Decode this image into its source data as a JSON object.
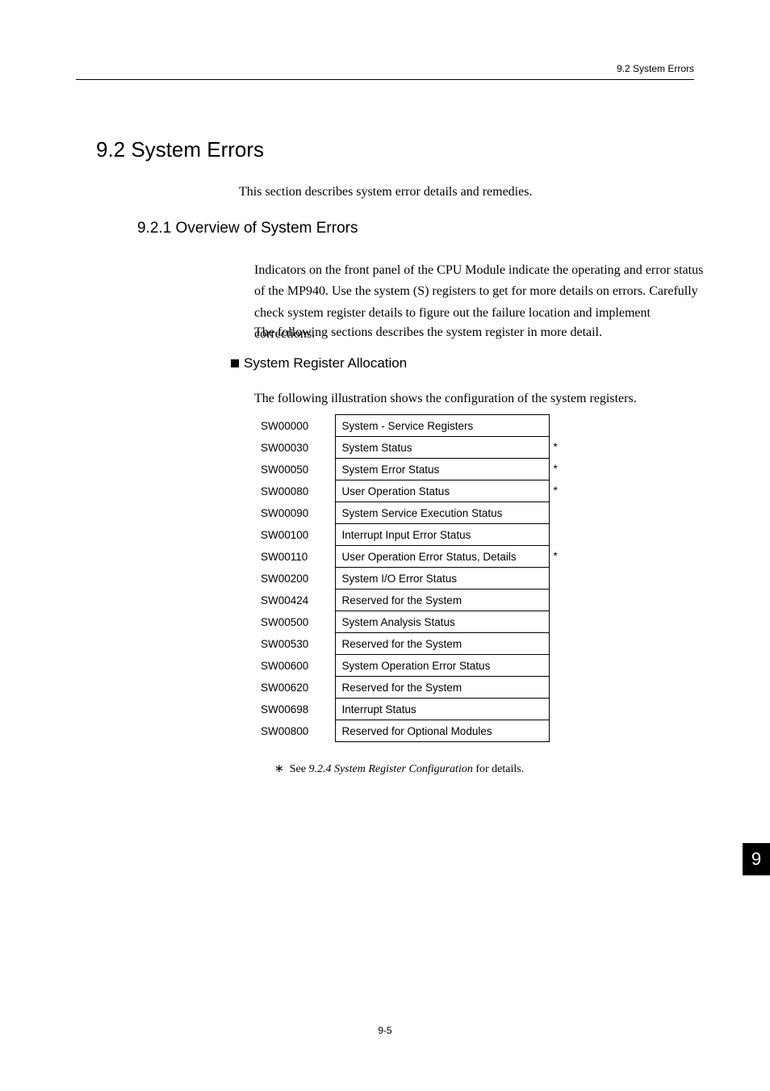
{
  "header": {
    "section_ref": "9.2  System Errors"
  },
  "section": {
    "title": "9.2  System Errors",
    "intro": "This section describes system error details and remedies."
  },
  "subsection": {
    "title": "9.2.1  Overview of System Errors",
    "para1": "Indicators on the front panel of the CPU Module indicate the operating and error status of the MP940. Use the system (S) registers to get for more details on errors. Carefully check system register details to figure out the failure location and implement corrections.",
    "para2": "The following sections describes the system register in more detail."
  },
  "bullet_heading": "System Register Allocation",
  "para3": "The following illustration shows the configuration of the system registers.",
  "registers": [
    {
      "label": "SW00000",
      "desc": "System - Service Registers",
      "note": ""
    },
    {
      "label": "SW00030",
      "desc": "System Status",
      "note": "*"
    },
    {
      "label": "SW00050",
      "desc": "System Error Status",
      "note": "*"
    },
    {
      "label": "SW00080",
      "desc": "User Operation Status",
      "note": "*"
    },
    {
      "label": "SW00090",
      "desc": "System Service Execution Status",
      "note": ""
    },
    {
      "label": "SW00100",
      "desc": "Interrupt Input Error Status",
      "note": ""
    },
    {
      "label": "SW00110",
      "desc": "User Operation Error Status, Details",
      "note": "*"
    },
    {
      "label": "SW00200",
      "desc": "System I/O Error Status",
      "note": ""
    },
    {
      "label": "SW00424",
      "desc": "Reserved for the System",
      "note": ""
    },
    {
      "label": "SW00500",
      "desc": "System Analysis Status",
      "note": ""
    },
    {
      "label": "SW00530",
      "desc": "Reserved for the System",
      "note": ""
    },
    {
      "label": "SW00600",
      "desc": "System Operation Error Status",
      "note": ""
    },
    {
      "label": "SW00620",
      "desc": "Reserved for the System",
      "note": ""
    },
    {
      "label": "SW00698",
      "desc": "Interrupt Status",
      "note": ""
    },
    {
      "label": "SW00800",
      "desc": "Reserved for Optional Modules",
      "note": ""
    }
  ],
  "footnote": {
    "mark": "∗",
    "pre": "See ",
    "italic": "9.2.4 System Register Configuration",
    "post": " for details."
  },
  "page_thumb": "9",
  "page_num": "9-5"
}
